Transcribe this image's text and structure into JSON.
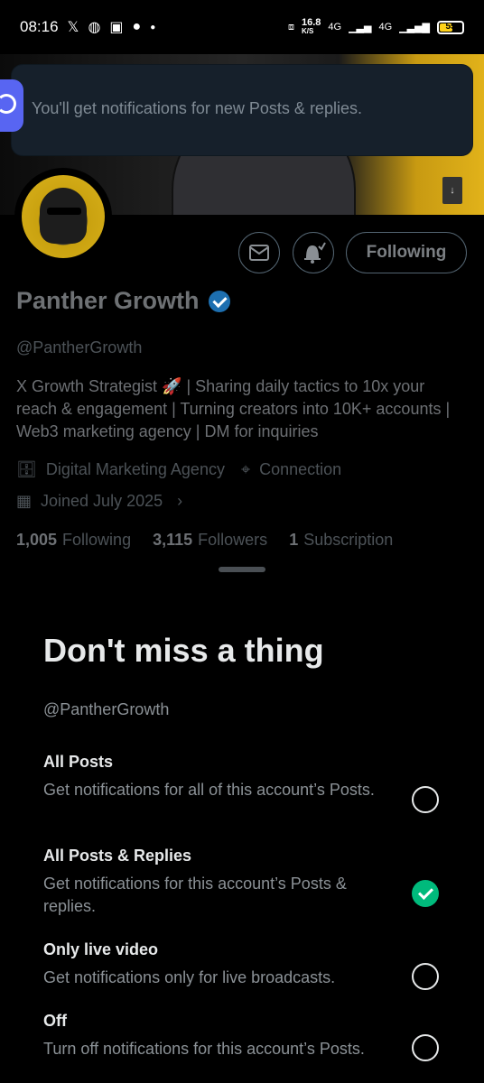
{
  "status_bar": {
    "time": "08:16",
    "net_speed": "16.8",
    "net_unit": "K/S",
    "network_1": "4G",
    "network_2": "4G",
    "battery": "55",
    "icons": [
      "x-icon",
      "whatsapp-icon",
      "instagram-icon",
      "messenger-icon",
      "dot-icon",
      "vibrate-icon",
      "signal-icon",
      "battery-icon"
    ]
  },
  "toast": {
    "message": "You'll get notifications for new Posts & replies."
  },
  "profile": {
    "name": "Panther Growth",
    "handle": "@PantherGrowth",
    "bio": "X Growth Strategist 🚀 | Sharing daily tactics to 10x your reach & engagement | Turning creators into 10K+ accounts | Web3 marketing agency | DM for inquiries",
    "category": "Digital Marketing Agency",
    "location": "Connection",
    "joined": "Joined July 2025",
    "following_count": "1,005",
    "following_label": "Following",
    "followers_count": "3,115",
    "followers_label": "Followers",
    "subscription_count": "1",
    "subscription_label": "Subscription",
    "follow_button": "Following"
  },
  "sheet": {
    "title": "Don't miss a thing",
    "handle": "@PantherGrowth",
    "options": [
      {
        "title": "All Posts",
        "desc": "Get notifications for all of this account’s Posts.",
        "selected": false
      },
      {
        "title": "All Posts & Replies",
        "desc": "Get notifications for this account’s Posts & replies.",
        "selected": true
      },
      {
        "title": "Only live video",
        "desc": "Get notifications only for live broadcasts.",
        "selected": false
      },
      {
        "title": "Off",
        "desc": "Turn off notifications for this account’s Posts.",
        "selected": false
      }
    ]
  },
  "colors": {
    "accent_green": "#00ba7c",
    "verified_blue": "#1d9bf0",
    "banner_yellow": "#e1b21a",
    "toast_bg": "#16202b"
  }
}
